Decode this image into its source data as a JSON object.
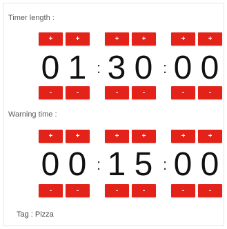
{
  "timer_length": {
    "label": "Timer length :",
    "digits": [
      "0",
      "1",
      "3",
      "0",
      "0",
      "0"
    ],
    "separators": [
      ":",
      ":"
    ],
    "increment_label": "+",
    "decrement_label": "-"
  },
  "warning_time": {
    "label": "Warning time :",
    "digits": [
      "0",
      "0",
      "1",
      "5",
      "0",
      "0"
    ],
    "separators": [
      ":",
      ":"
    ],
    "increment_label": "+",
    "decrement_label": "-"
  },
  "tag": {
    "text": "Tag : Pizza"
  },
  "colors": {
    "button": "#e32219",
    "digit": "#111111",
    "label": "#5a5a5a"
  }
}
